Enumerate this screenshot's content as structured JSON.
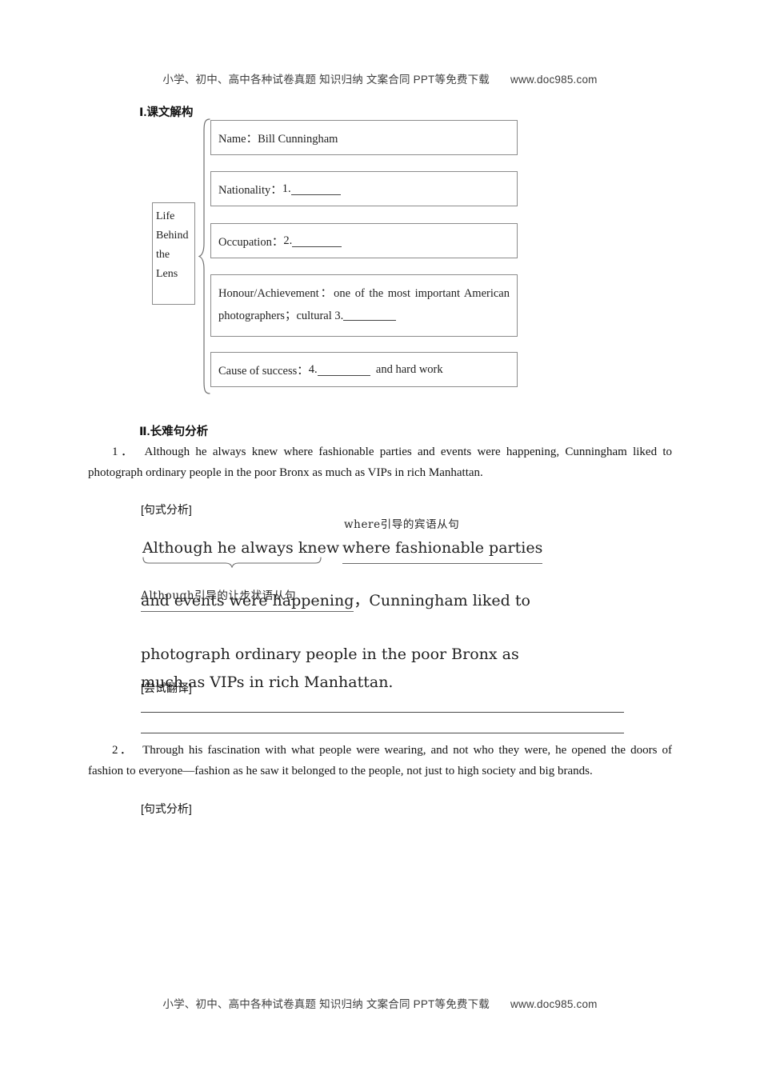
{
  "runner": {
    "text_cn": "小学、初中、高中各种试卷真题 知识归纳 文案合同 PPT等免费下载",
    "site": "www.doc985.com"
  },
  "sections": {
    "one_heading": "Ⅰ.课文解构",
    "two_heading": "Ⅱ.长难句分析"
  },
  "diagram": {
    "topic": {
      "line1": "Life",
      "line2": "Behind",
      "line3": "the",
      "line4": "Lens"
    },
    "items": [
      {
        "label": "Name：Bill Cunningham",
        "prefix": "Name：Bill Cunningham",
        "number": "",
        "suffix": ""
      },
      {
        "label": "Nationality：1. ________",
        "prefix": "Nationality：",
        "number": "1.",
        "suffix": ""
      },
      {
        "label": "Occupation：2. ________",
        "prefix": "Occupation：",
        "number": "2.",
        "suffix": ""
      },
      {
        "label": "Honour/Achievement：one of the most important American photographers；cultural 3. ________",
        "prefix": "Honour/Achievement：one of the most important American photographers；cultural",
        "number": "3.",
        "suffix": ""
      },
      {
        "label": "Cause of success：4. ________ and hard work",
        "prefix": "Cause of success：",
        "number": "4.",
        "suffix": "and hard work"
      }
    ]
  },
  "sentence1": {
    "number": "1．",
    "text": "Although he always knew where fashionable parties and events were happening, Cunningham liked to photograph ordinary people in the poor Bronx as much as VIPs in rich Manhattan.",
    "analysis_label": "[句式分析]",
    "translate_label": "[尝试翻译]",
    "breakdown": {
      "note_object": "where引导的宾语从句",
      "note_although": "Although引导的让步状语从句",
      "line1_left": "Although he always knew",
      "line1_right": "where fashionable parties",
      "line2_underlined": "and events were happening",
      "line2_rest": "，Cunningham liked to",
      "line3": "photograph ordinary people in the poor Bronx as",
      "line4": "much as VIPs in rich Manhattan."
    }
  },
  "sentence2": {
    "number": "2．",
    "text": "Through his fascination with what people were wearing, and not who they were, he opened the doors of fashion to everyone—fashion as he saw it belonged to the people, not just to high society and big brands.",
    "analysis_label": "[句式分析]"
  },
  "colors": {
    "text": "#1a1a1a",
    "box_border": "#8c8c8c",
    "rule": "#4a4a4a",
    "runner": "#3d3d3d"
  }
}
